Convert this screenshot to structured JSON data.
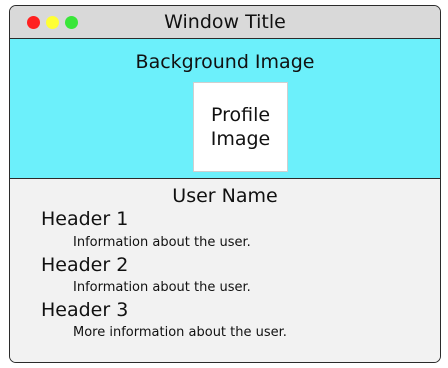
{
  "window": {
    "title": "Window Title",
    "controls": [
      "close",
      "minimize",
      "zoom"
    ]
  },
  "hero": {
    "background_label": "Background Image",
    "profile_label_line1": "Profile",
    "profile_label_line2": "Image"
  },
  "profile": {
    "user_name": "User Name",
    "sections": [
      {
        "header": "Header 1",
        "info": "Information about the user."
      },
      {
        "header": "Header 2",
        "info": "Information about the user."
      },
      {
        "header": "Header 3",
        "info": "More information about the user."
      }
    ]
  },
  "colors": {
    "hero_background": "#6cf0fb",
    "titlebar": "#d9d9d9",
    "content_background": "#f2f2f2",
    "close": "#ff2020",
    "minimize": "#ffff33",
    "zoom": "#39e639"
  }
}
